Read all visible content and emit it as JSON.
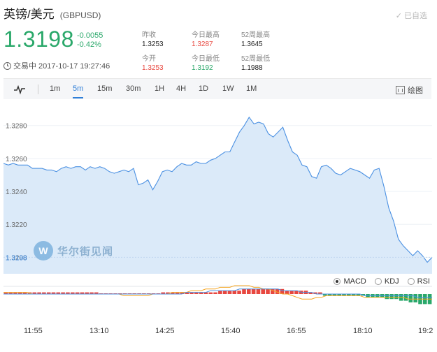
{
  "header": {
    "name": "英镑/美元",
    "code": "(GBPUSD)",
    "followed_label": "已自选",
    "price": "1.3198",
    "change": "-0.0055",
    "change_pct": "-0.42%",
    "status": "交易中 2017-10-17 19:27:46",
    "colors": {
      "down": "#2aa86a",
      "up": "#e8473f",
      "accent": "#2f7fd8"
    }
  },
  "stats": [
    {
      "label": "昨收",
      "value": "1.3253",
      "tone": "neutral"
    },
    {
      "label": "今日最高",
      "value": "1.3287",
      "tone": "red"
    },
    {
      "label": "52周最高",
      "value": "1.3645",
      "tone": "neutral"
    },
    {
      "label": "今开",
      "value": "1.3253",
      "tone": "red"
    },
    {
      "label": "今日最低",
      "value": "1.3192",
      "tone": "green"
    },
    {
      "label": "52周最低",
      "value": "1.1988",
      "tone": "neutral"
    }
  ],
  "toolbar": {
    "timeframes": [
      "1m",
      "5m",
      "15m",
      "30m",
      "1H",
      "4H",
      "1D",
      "1W",
      "1M"
    ],
    "active": "5m",
    "draw_label": "绘图"
  },
  "indicators": [
    {
      "label": "MACD",
      "selected": true
    },
    {
      "label": "KDJ",
      "selected": false
    },
    {
      "label": "RSI",
      "selected": false
    }
  ],
  "watermark": "华尔街见闻",
  "chart_data": {
    "type": "area",
    "y_ticks": [
      "1.3280",
      "1.3260",
      "1.3240",
      "1.3220",
      "1.3200"
    ],
    "ylim": [
      1.319,
      1.3296
    ],
    "x_ticks": [
      "11:55",
      "13:10",
      "14:25",
      "15:40",
      "16:55",
      "18:10",
      "19:2"
    ],
    "last_price_label": "1.3198",
    "series": [
      {
        "values": [
          1.3257,
          1.3256,
          1.3257,
          1.3256,
          1.3256,
          1.3256,
          1.3254,
          1.3254,
          1.3254,
          1.3253,
          1.3253,
          1.3252,
          1.3254,
          1.3255,
          1.3254,
          1.3255,
          1.3255,
          1.3253,
          1.3255,
          1.3254,
          1.3255,
          1.3254,
          1.3252,
          1.3251,
          1.3252,
          1.3253,
          1.3252,
          1.3254,
          1.3244,
          1.3245,
          1.3247,
          1.3241,
          1.3246,
          1.3252,
          1.3253,
          1.3252,
          1.3255,
          1.3257,
          1.3256,
          1.3256,
          1.3258,
          1.3257,
          1.3257,
          1.3259,
          1.326,
          1.3262,
          1.3264,
          1.3264,
          1.327,
          1.3276,
          1.328,
          1.3285,
          1.3281,
          1.3282,
          1.3281,
          1.3275,
          1.3273,
          1.3276,
          1.3279,
          1.3271,
          1.3264,
          1.3262,
          1.3256,
          1.3255,
          1.3249,
          1.3248,
          1.3255,
          1.3256,
          1.3254,
          1.3251,
          1.325,
          1.3252,
          1.3254,
          1.3253,
          1.3252,
          1.325,
          1.3248,
          1.3253,
          1.3254,
          1.3243,
          1.323,
          1.3222,
          1.3211,
          1.3207,
          1.3204,
          1.3201,
          1.3204,
          1.3201,
          1.3197,
          1.32
        ]
      }
    ],
    "macd": {
      "histogram": [
        1,
        1,
        1,
        1,
        1,
        1,
        1,
        1,
        1,
        1,
        1,
        1,
        1,
        1,
        1,
        1,
        1,
        1,
        1,
        1,
        0,
        0,
        0,
        0,
        0,
        0,
        0,
        0,
        0,
        0,
        0,
        0,
        0,
        1,
        1,
        1,
        1,
        1,
        1,
        1,
        1,
        1,
        1,
        1,
        1,
        2,
        2,
        2,
        2,
        2,
        3,
        3,
        3,
        3,
        3,
        3,
        3,
        3,
        3,
        2,
        2,
        2,
        2,
        2,
        1,
        1,
        1,
        -1,
        -1,
        -1,
        -1,
        -1,
        -1,
        -1,
        -1,
        -1,
        -2,
        -2,
        -2,
        -2,
        -3,
        -3,
        -3,
        -4,
        -4,
        -5,
        -5,
        -6,
        -6,
        -6
      ],
      "dif": [
        1,
        1,
        1,
        1,
        1,
        1,
        0,
        0,
        0,
        0,
        0,
        0,
        0,
        0,
        0,
        0,
        0,
        0,
        0,
        0,
        0,
        0,
        0,
        0,
        0,
        -1,
        -1,
        -1,
        -1,
        -1,
        -1,
        0,
        0,
        0,
        0,
        1,
        1,
        1,
        1,
        2,
        2,
        2,
        3,
        3,
        3,
        4,
        4,
        4,
        5,
        5,
        5,
        5,
        4,
        4,
        3,
        3,
        2,
        1,
        0,
        0,
        -1,
        -2,
        -3,
        -3,
        -3,
        -2,
        -2,
        -1,
        -1,
        -1,
        -1,
        -1,
        -1,
        -1,
        -1,
        -2,
        -2,
        -2,
        -2,
        -2,
        -2,
        -2,
        -2,
        -2,
        -3,
        -3,
        -3,
        -3,
        -3,
        -3
      ],
      "dea": [
        0,
        0,
        0,
        0,
        0,
        0,
        0,
        0,
        0,
        0,
        0,
        0,
        0,
        0,
        0,
        0,
        0,
        0,
        0,
        0,
        0,
        0,
        0,
        0,
        0,
        0,
        0,
        0,
        0,
        0,
        0,
        0,
        0,
        0,
        0,
        0,
        0,
        0,
        1,
        1,
        1,
        1,
        1,
        2,
        2,
        2,
        2,
        2,
        2,
        3,
        3,
        3,
        3,
        3,
        3,
        3,
        3,
        3,
        2,
        2,
        2,
        2,
        1,
        1,
        1,
        0,
        0,
        0,
        0,
        0,
        0,
        0,
        0,
        0,
        0,
        -1,
        -1,
        -1,
        -1,
        -1,
        -1,
        -1,
        -1,
        -1,
        -1,
        -1,
        -2,
        -2,
        -2,
        -2
      ]
    }
  }
}
